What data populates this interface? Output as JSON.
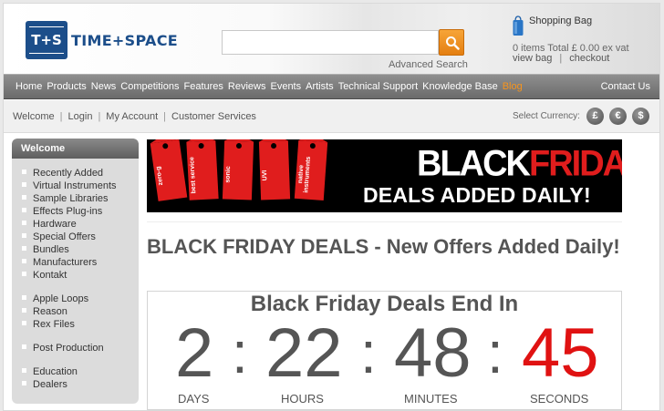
{
  "header": {
    "logo_mark": "T+S",
    "logo_text": "TIME+SPACE",
    "search_placeholder": "",
    "advanced_search": "Advanced Search",
    "bag": {
      "title": "Shopping Bag",
      "summary": "0 items  Total £ 0.00 ex vat",
      "view": "view bag",
      "checkout": "checkout"
    }
  },
  "nav": {
    "items": [
      "Home",
      "Products",
      "News",
      "Competitions",
      "Features",
      "Reviews",
      "Events",
      "Artists",
      "Technical Support",
      "Knowledge Base",
      "Blog"
    ],
    "contact": "Contact Us",
    "active_color": "#f7941d"
  },
  "subbar": {
    "links": [
      "Welcome",
      "Login",
      "My Account",
      "Customer Services"
    ],
    "currency_label": "Select Currency:",
    "currencies": [
      "£",
      "€",
      "$"
    ]
  },
  "sidebar": {
    "heading": "Welcome",
    "groups": [
      [
        "Recently Added",
        "Virtual Instruments",
        "Sample Libraries",
        "Effects Plug-ins",
        "Hardware",
        "Special Offers",
        "Bundles",
        "Manufacturers",
        "Kontakt"
      ],
      [
        "Apple Loops",
        "Reason",
        "Rex Files"
      ],
      [
        "Post Production"
      ],
      [
        "Education",
        "Dealers"
      ]
    ]
  },
  "banner": {
    "title_black": "BLACK",
    "title_friday": "FRIDAY",
    "subtitle": "DEALS ADDED DAILY!",
    "tags": [
      "zero-g",
      "best service",
      "sonic",
      "UVI",
      "native instruments"
    ]
  },
  "main": {
    "title": "BLACK FRIDAY DEALS - New Offers Added Daily!"
  },
  "countdown": {
    "title": "Black Friday Deals End In",
    "units": [
      {
        "value": "2",
        "label": "DAYS"
      },
      {
        "value": "22",
        "label": "HOURS"
      },
      {
        "value": "48",
        "label": "MINUTES"
      },
      {
        "value": "45",
        "label": "SECONDS"
      }
    ],
    "separator": ":",
    "highlight_color": "#e01212"
  }
}
